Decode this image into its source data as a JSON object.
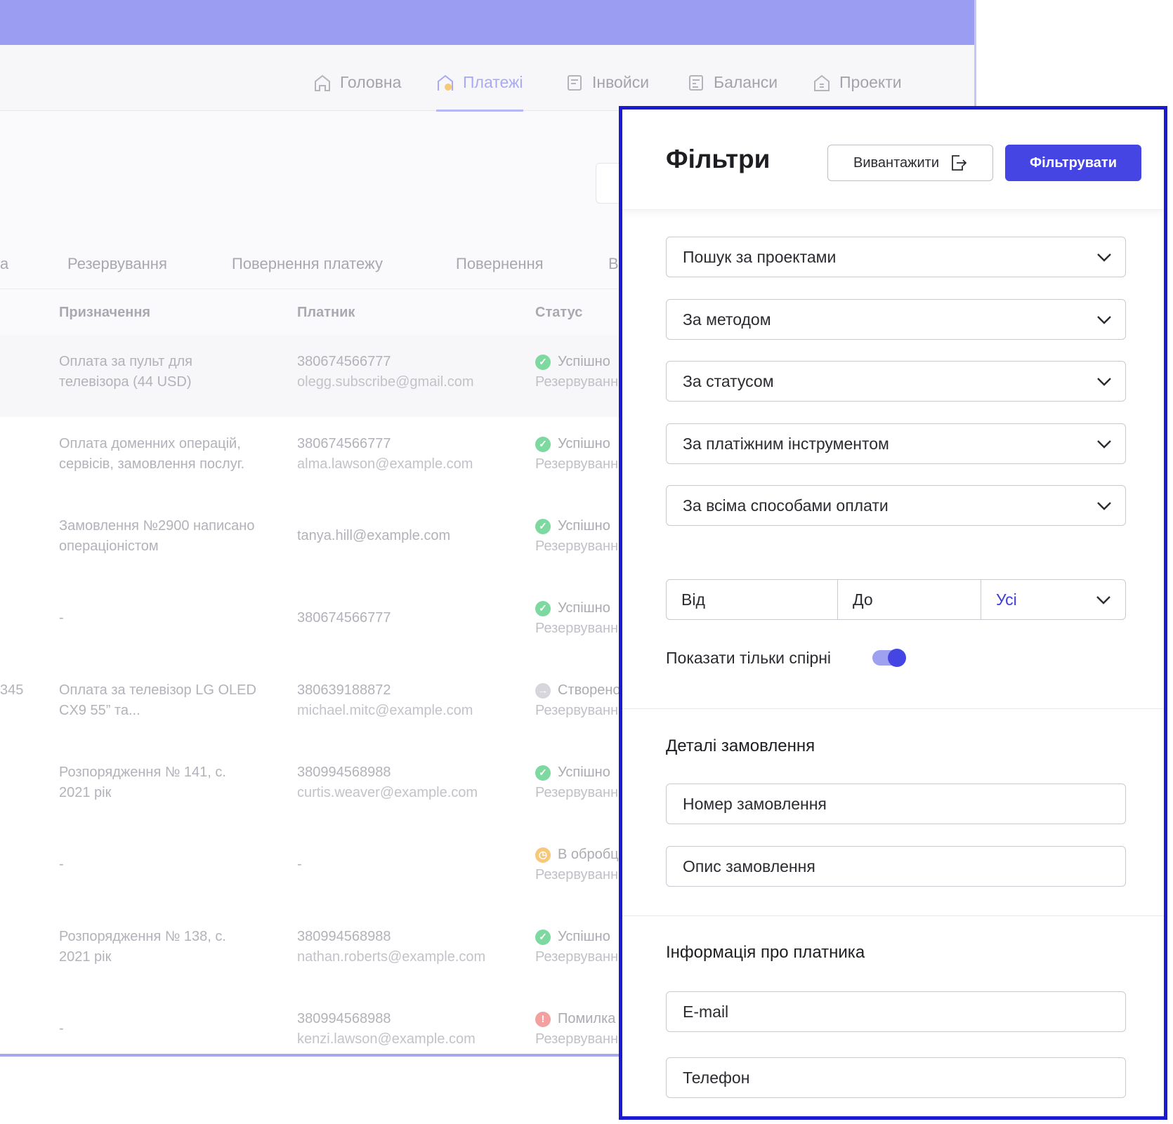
{
  "nav": {
    "items": [
      {
        "label": "Головна",
        "icon": "home-icon",
        "active": false
      },
      {
        "label": "Платежі",
        "icon": "payments-home-icon",
        "active": true
      },
      {
        "label": "Інвойси",
        "icon": "invoice-icon",
        "active": false
      },
      {
        "label": "Баланси",
        "icon": "balance-icon",
        "active": false
      },
      {
        "label": "Проекти",
        "icon": "projects-icon",
        "active": false
      }
    ]
  },
  "tabs": [
    "а",
    "Резервування",
    "Повернення платежу",
    "Повернення",
    "В"
  ],
  "table": {
    "headers": {
      "purpose": "Призначення",
      "payer": "Платник",
      "status": "Статус"
    },
    "rows": [
      {
        "id": "",
        "purpose": [
          "Оплата за пульт для",
          "телевізора (44 USD)"
        ],
        "payer": [
          "380674566777",
          "olegg.subscribe@gmail.com"
        ],
        "status": "Успішно",
        "status_sub": "Резервуванн",
        "status_kind": "success"
      },
      {
        "id": "",
        "purpose": [
          "Оплата доменних операцій,",
          "сервісів, замовлення послуг."
        ],
        "payer": [
          "380674566777",
          "alma.lawson@example.com"
        ],
        "status": "Успішно",
        "status_sub": "Резервуванн",
        "status_kind": "success"
      },
      {
        "id": "",
        "purpose": [
          "Замовлення №2900 написано",
          "операціоністом"
        ],
        "payer": [
          "tanya.hill@example.com",
          ""
        ],
        "status": "Успішно",
        "status_sub": "Резервуванн",
        "status_kind": "success"
      },
      {
        "id": "",
        "purpose": [
          "-",
          ""
        ],
        "payer": [
          "380674566777",
          ""
        ],
        "status": "Успішно",
        "status_sub": "Резервуванн",
        "status_kind": "success"
      },
      {
        "id": "345",
        "purpose": [
          "Оплата за телевізор LG OLED",
          "CX9 55” та..."
        ],
        "payer": [
          "380639188872",
          "michael.mitc@example.com"
        ],
        "status": "Створено",
        "status_sub": "Резервуванн",
        "status_kind": "created"
      },
      {
        "id": "",
        "purpose": [
          "Розпорядження № 141, с.",
          "2021 рік"
        ],
        "payer": [
          "380994568988",
          "curtis.weaver@example.com"
        ],
        "status": "Успішно",
        "status_sub": "Резервуванн",
        "status_kind": "success"
      },
      {
        "id": "",
        "purpose": [
          "-",
          ""
        ],
        "payer": [
          "-",
          ""
        ],
        "status": "В обробці",
        "status_sub": "Резервуванн",
        "status_kind": "processing"
      },
      {
        "id": "",
        "purpose": [
          "Розпорядження № 138, с.",
          "2021 рік"
        ],
        "payer": [
          "380994568988",
          "nathan.roberts@example.com"
        ],
        "status": "Успішно",
        "status_sub": "Резервуванн",
        "status_kind": "success"
      },
      {
        "id": "",
        "purpose": [
          "-",
          ""
        ],
        "payer": [
          "380994568988",
          "kenzi.lawson@example.com"
        ],
        "status": "Помилка",
        "status_sub": "Резервуванн",
        "status_kind": "error"
      }
    ]
  },
  "colors": {
    "accent": "#4545e3",
    "panel_border": "#1a1ad1",
    "topbar": "#9b9df2",
    "success": "#7dd9a0",
    "created": "#d6d6dc",
    "processing": "#f7c879",
    "error": "#f2a0a0"
  },
  "filters": {
    "title": "Фільтри",
    "export_label": "Вивантажити",
    "filter_label": "Фільтрувати",
    "selects": [
      "Пошук за проектами",
      "За методом",
      "За статусом",
      "За платіжним інструментом",
      "За всіма способами оплати"
    ],
    "range": {
      "from": "Від",
      "to": "До",
      "scope": "Усі"
    },
    "disputed_label": "Показати тільки спірні",
    "disputed_on": true,
    "order_section": "Деталі замовлення",
    "order_number": "Номер замовлення",
    "order_description": "Опис замовлення",
    "payer_section": "Інформація про платника",
    "email": "E-mail",
    "phone": "Телефон"
  }
}
